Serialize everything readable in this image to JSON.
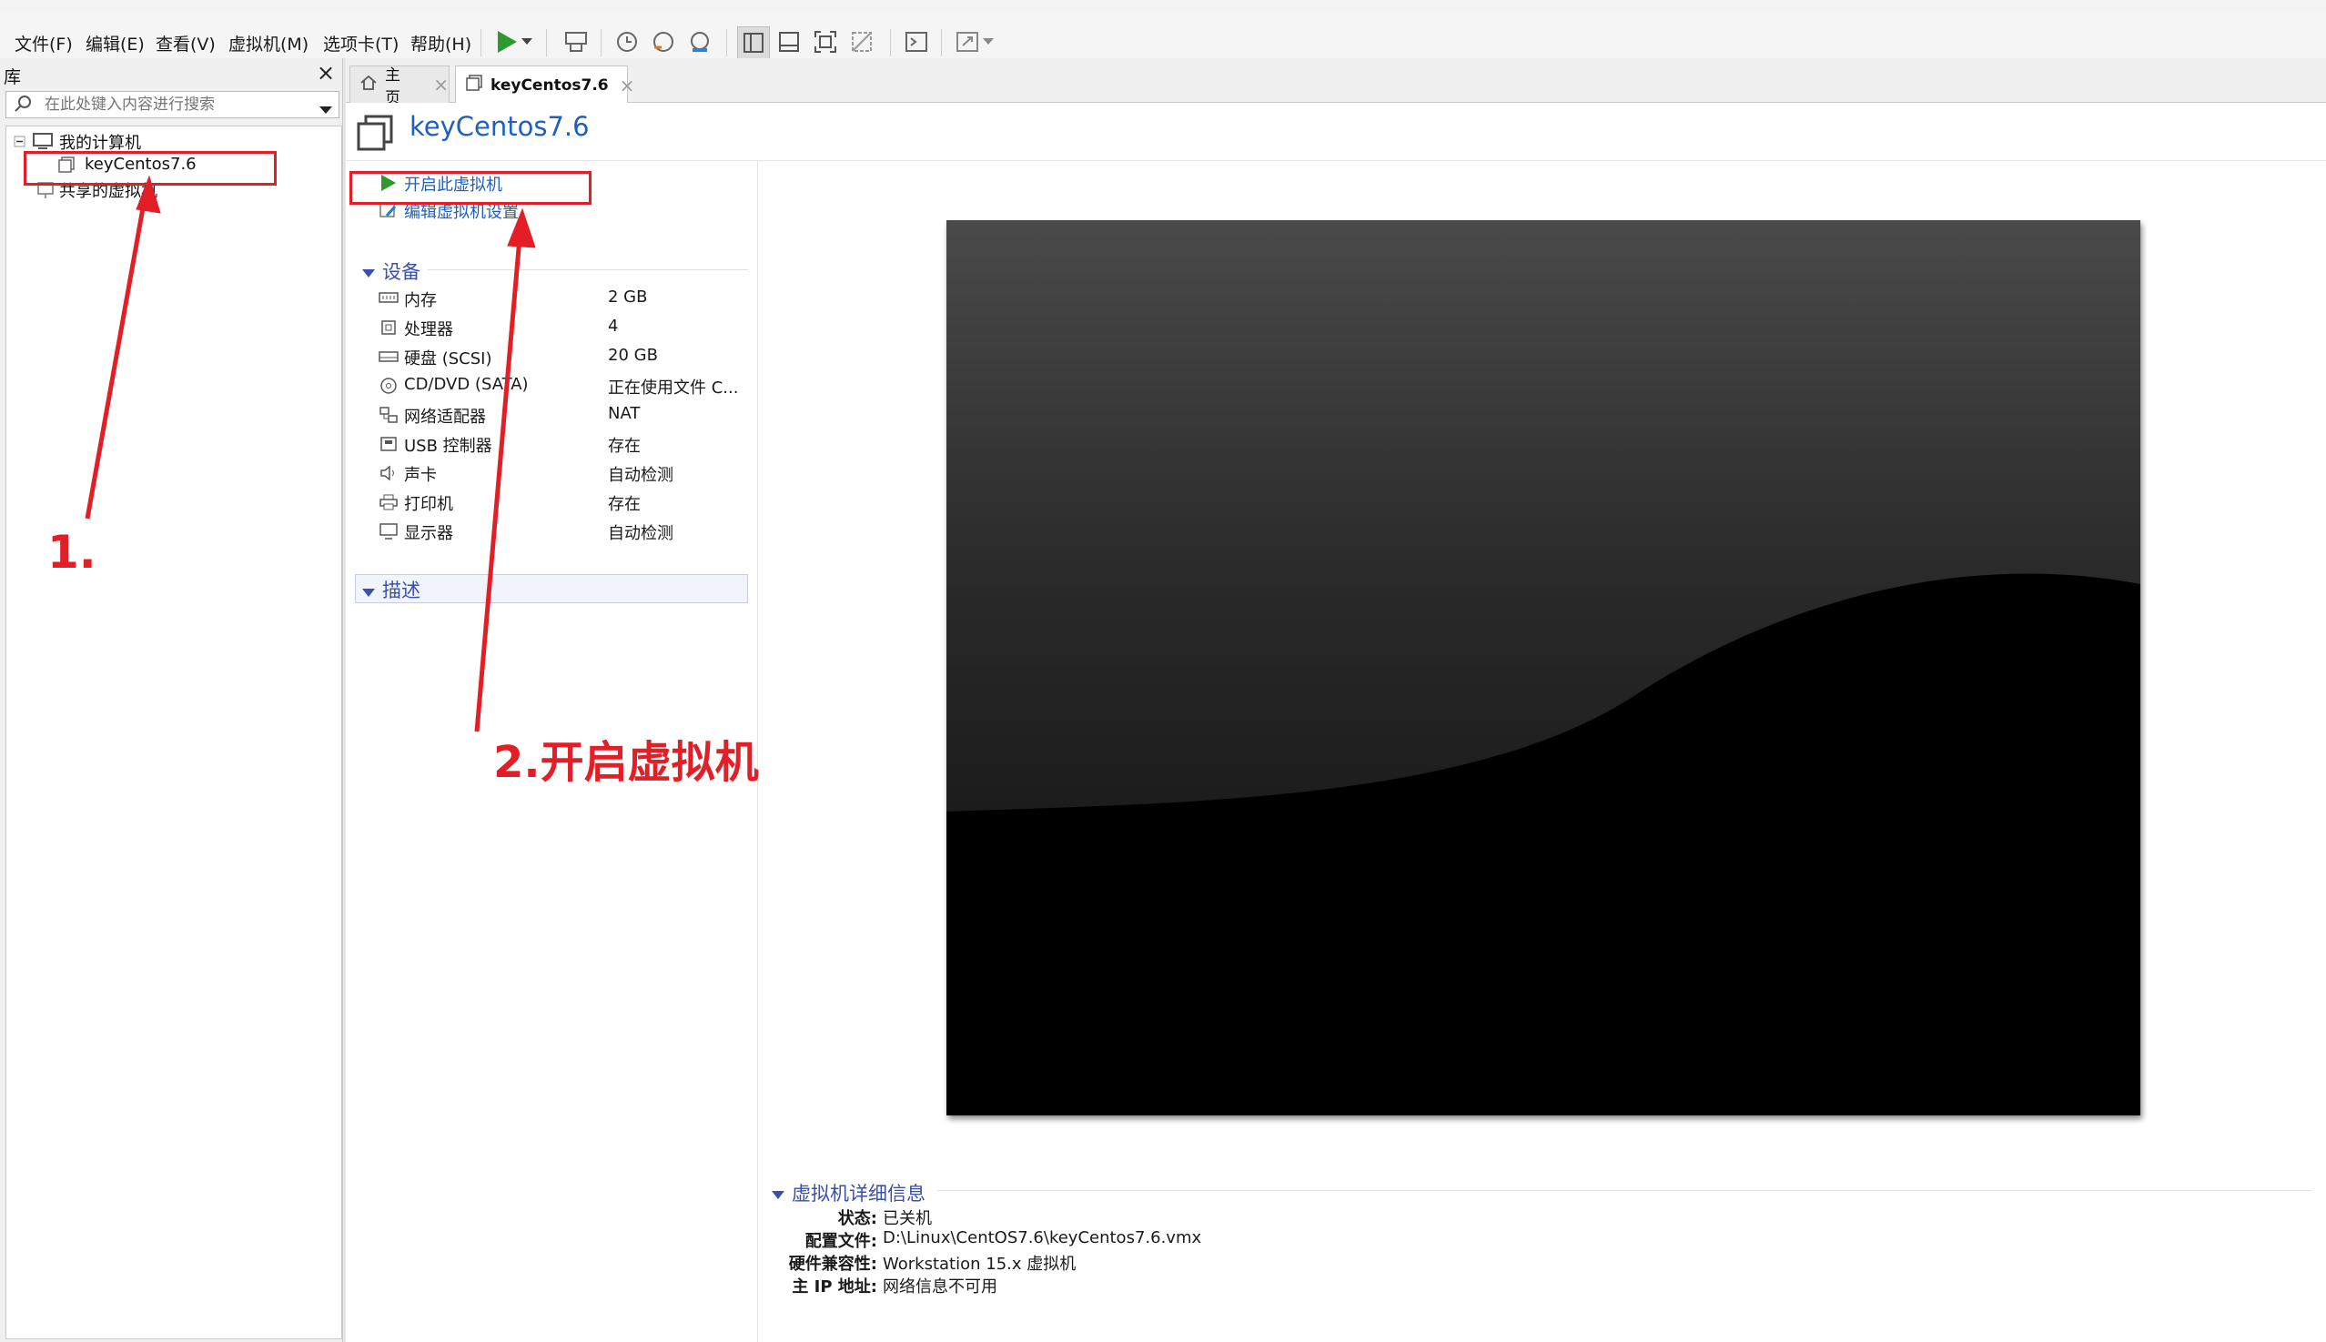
{
  "menu": {
    "items": [
      "文件(F)",
      "编辑(E)",
      "查看(V)",
      "虚拟机(M)",
      "选项卡(T)",
      "帮助(H)"
    ]
  },
  "toolbar": {
    "icons": [
      "play-icon",
      "dropdown-arrow-icon",
      "send-keys-icon",
      "snapshot-icon",
      "revert-snapshot-icon",
      "snapshot-manager-icon",
      "library-view-icon",
      "thumbnail-view-icon",
      "fullscreen-icon",
      "unity-icon",
      "console-icon",
      "stretch-icon"
    ]
  },
  "library": {
    "title": "库",
    "close": "×",
    "search_placeholder": "在此处键入内容进行搜索",
    "tree": {
      "root": "我的计算机",
      "vm": "keyCentos7.6",
      "shared": "共享的虚拟机"
    }
  },
  "tabs": [
    {
      "label": "主页",
      "close": "×"
    },
    {
      "label": "keyCentos7.6",
      "close": "×"
    }
  ],
  "vm": {
    "title": "keyCentos7.6",
    "actions": {
      "power_on": "开启此虚拟机",
      "edit_settings": "编辑虚拟机设置"
    },
    "devices_heading": "设备",
    "devices": [
      {
        "name": "内存",
        "value": "2 GB",
        "icon": "memory-icon"
      },
      {
        "name": "处理器",
        "value": "4",
        "icon": "cpu-icon"
      },
      {
        "name": "硬盘 (SCSI)",
        "value": "20 GB",
        "icon": "harddisk-icon"
      },
      {
        "name": "CD/DVD (SATA)",
        "value": "正在使用文件 C...",
        "icon": "cdrom-icon"
      },
      {
        "name": "网络适配器",
        "value": "NAT",
        "icon": "network-icon"
      },
      {
        "name": "USB 控制器",
        "value": "存在",
        "icon": "usb-icon"
      },
      {
        "name": "声卡",
        "value": "自动检测",
        "icon": "sound-icon"
      },
      {
        "name": "打印机",
        "value": "存在",
        "icon": "printer-icon"
      },
      {
        "name": "显示器",
        "value": "自动检测",
        "icon": "display-icon"
      }
    ],
    "description_heading": "描述",
    "details_heading": "虚拟机详细信息",
    "details": [
      {
        "label": "状态:",
        "value": "已关机"
      },
      {
        "label": "配置文件:",
        "value": "D:\\Linux\\CentOS7.6\\keyCentos7.6.vmx"
      },
      {
        "label": "硬件兼容性:",
        "value": "Workstation 15.x 虚拟机"
      },
      {
        "label": "主 IP 地址:",
        "value": "网络信息不可用"
      }
    ]
  },
  "annotations": {
    "step1": "1.",
    "step2": "2.开启虚拟机",
    "color": "#e21f26"
  },
  "colors": {
    "link": "#1f5fbf",
    "heading": "#3a4fae",
    "play": "#2e9a2e"
  }
}
